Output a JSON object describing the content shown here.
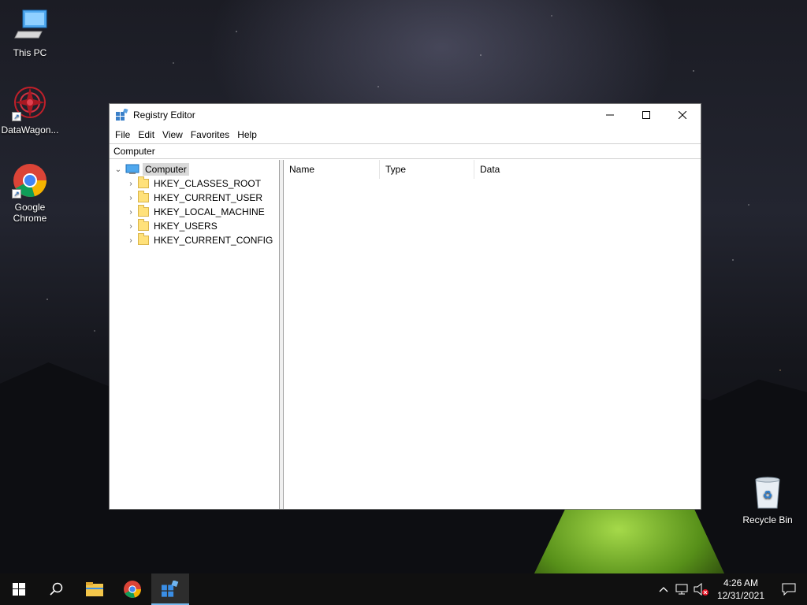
{
  "desktop": {
    "icons": [
      {
        "label": "This PC",
        "icon": "this-pc-icon"
      },
      {
        "label": "DataWagon...",
        "icon": "datawagon-icon"
      },
      {
        "label": "Google Chrome",
        "icon": "chrome-icon"
      },
      {
        "label": "Recycle Bin",
        "icon": "recycle-bin-icon"
      }
    ]
  },
  "window": {
    "title": "Registry Editor",
    "menu": [
      "File",
      "Edit",
      "View",
      "Favorites",
      "Help"
    ],
    "address": "Computer",
    "tree": {
      "root": "Computer",
      "hives": [
        "HKEY_CLASSES_ROOT",
        "HKEY_CURRENT_USER",
        "HKEY_LOCAL_MACHINE",
        "HKEY_USERS",
        "HKEY_CURRENT_CONFIG"
      ]
    },
    "columns": [
      "Name",
      "Type",
      "Data"
    ]
  },
  "taskbar": {
    "time": "4:26 AM",
    "date": "12/31/2021"
  },
  "colors": {
    "taskbar_bg": "#101010",
    "accent": "#76b9ed",
    "folder": "#ffe17a"
  }
}
